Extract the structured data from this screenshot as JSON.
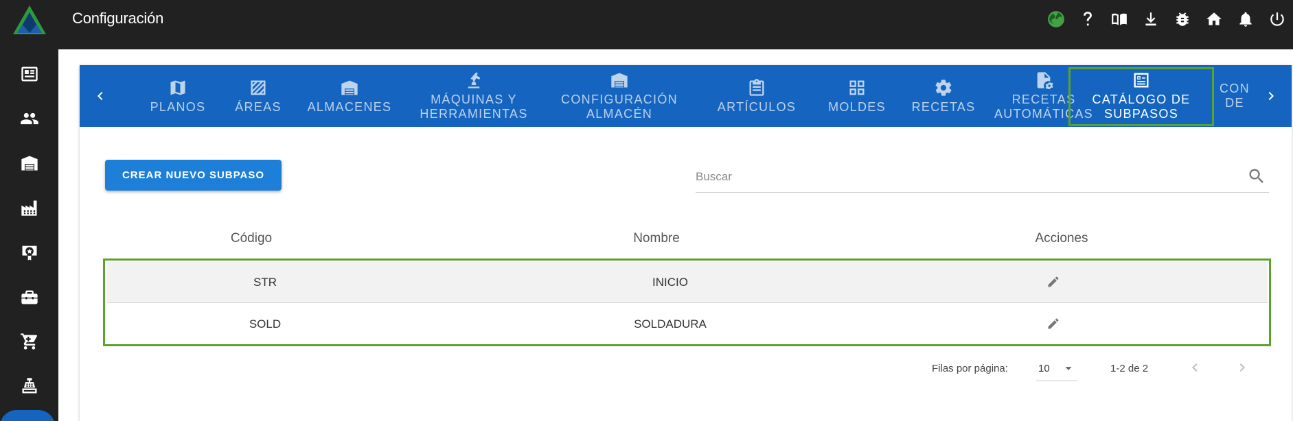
{
  "app": {
    "title": "Configuración",
    "top_icons": [
      "globe-icon",
      "help-icon",
      "book-icon",
      "download-icon",
      "bug-icon",
      "home-icon",
      "bell-icon",
      "power-icon"
    ]
  },
  "sidebar": {
    "items": [
      "news-icon",
      "users-icon",
      "warehouse-icon",
      "factory-icon",
      "certificate-icon",
      "toolbox-icon",
      "cart-icon",
      "register-icon"
    ]
  },
  "tabs": [
    {
      "label": "PLANOS",
      "icon": "map-icon"
    },
    {
      "label": "ÁREAS",
      "icon": "area-icon"
    },
    {
      "label": "ALMACENES",
      "icon": "warehouse-icon"
    },
    {
      "label": "MÁQUINAS Y\nHERRAMIENTAS",
      "icon": "robot-arm-icon"
    },
    {
      "label": "CONFIGURACIÓN\nALMACÉN",
      "icon": "warehouse-config-icon"
    },
    {
      "label": "ARTÍCULOS",
      "icon": "clipboard-icon"
    },
    {
      "label": "MOLDES",
      "icon": "grid-icon"
    },
    {
      "label": "RECETAS",
      "icon": "cogs-icon"
    },
    {
      "label": "RECETAS\nAUTOMÁTICAS",
      "icon": "file-cog-icon"
    },
    {
      "label": "CATÁLOGO DE\nSUBPASOS",
      "icon": "list-box-icon",
      "active": true
    },
    {
      "label": "CON\nDE",
      "icon": ""
    }
  ],
  "toolbar": {
    "create_label": "CREAR NUEVO SUBPASO",
    "search_placeholder": "Buscar",
    "search_value": ""
  },
  "table": {
    "headers": [
      "Código",
      "Nombre",
      "Acciones"
    ],
    "rows": [
      {
        "codigo": "STR",
        "nombre": "INICIO"
      },
      {
        "codigo": "SOLD",
        "nombre": "SOLDADURA"
      }
    ]
  },
  "pagination": {
    "rows_per_page_label": "Filas por página:",
    "rows_per_page": "10",
    "range": "1-2 de 2"
  },
  "colors": {
    "topbar": "#212121",
    "tabs": "#1565c0",
    "button": "#1e7fd9",
    "highlight": "#59a32c"
  }
}
